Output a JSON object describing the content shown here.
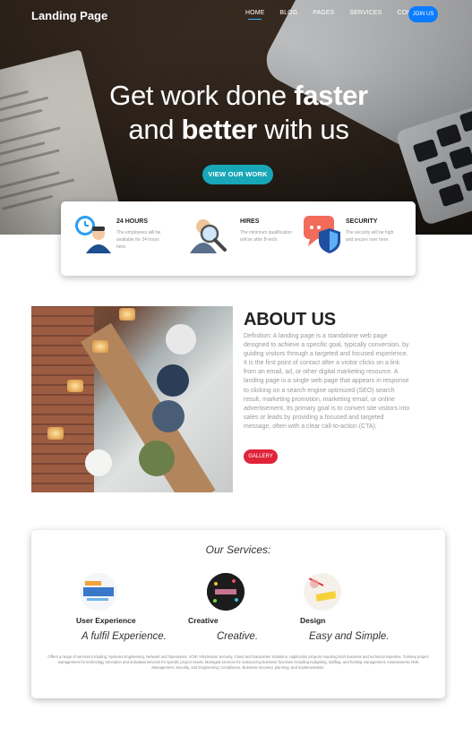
{
  "nav": {
    "brand": "Landing Page",
    "links": [
      {
        "label": "HOME",
        "active": true
      },
      {
        "label": "BLOG",
        "active": false
      },
      {
        "label": "PAGES",
        "active": false
      },
      {
        "label": "SERVICES",
        "active": false
      },
      {
        "label": "CONTACT",
        "active": false
      }
    ],
    "join_label": "JOIN US"
  },
  "hero": {
    "line1_pre": "Get work done ",
    "line1_bold": "faster",
    "line2_pre": "and ",
    "line2_bold": "better",
    "line2_post": " with us",
    "cta_label": "VIEW OUR WORK"
  },
  "features": [
    {
      "title": "24 HOURS",
      "description": "The employees will be available for 24 hours here.",
      "icon": "clock-person-icon"
    },
    {
      "title": "HIRES",
      "description": "The minimum qualification will be after B-tech.",
      "icon": "magnifier-person-icon"
    },
    {
      "title": "SECURITY",
      "description": "The security will be high and secure over here.",
      "icon": "shield-chat-icon"
    }
  ],
  "about": {
    "title": "ABOUT US",
    "text": "Definition: A landing page is a standalone web page designed to achieve a specific goal, typically conversion, by guiding visitors through a targeted and focused experience. It is the first point of contact after a visitor clicks on a link from an email, ad, or other digital marketing resource. A landing page is a single web page that appears in response to clicking on a search engine optimized (SEO) search result, marketing promotion, marketing email, or online advertisement. Its primary goal is to convert site visitors into sales or leads by providing a focused and targeted message, often with a clear call-to-action (CTA).",
    "button_label": "GALLERY"
  },
  "services": {
    "heading": "Our Services:",
    "items": [
      {
        "name": "User Experience",
        "tagline": "A fulfil Experience."
      },
      {
        "name": "Creative",
        "tagline": "Creative."
      },
      {
        "name": "Design",
        "tagline": "Easy and Simple."
      }
    ],
    "description": "Offers a range of services including: Systems Engineering, Network and Operations, VOIP, Information Security, Cloud and Datacenter Solutions, Application projects requiring both business and technical expertise. Turnkey project management for technology relocation and individual services for specific project needs. Managed services for outsourcing business functions including budgeting, staffing, and hosting management; Assessments; Risk Management; Security, and Engineering; Compliance; Business recovery, planning, and implementation."
  },
  "colors": {
    "accent_blue": "#0a7cff",
    "cta_teal": "#18a7b8",
    "gallery_red": "#e0243a"
  }
}
